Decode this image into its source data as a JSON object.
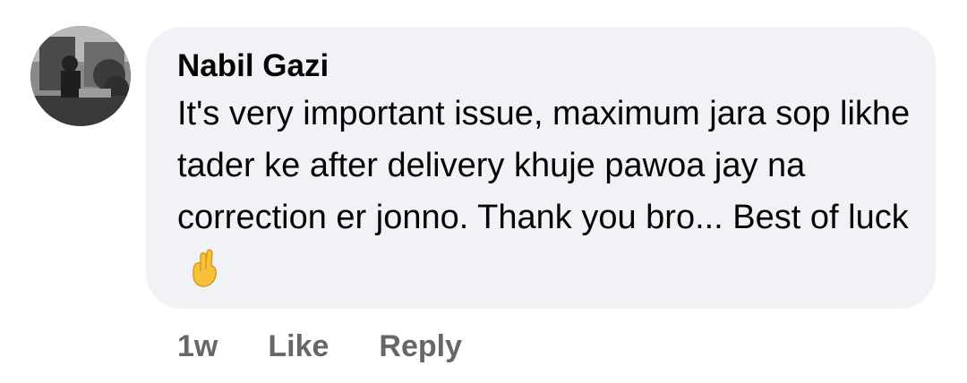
{
  "comment": {
    "author": "Nabil Gazi",
    "text": "It's very important issue, maximum jara sop likhe tader ke after delivery khuje pawoa jay na correction er jonno. Thank you bro... Best of luck",
    "emoji": "crossed-fingers-icon",
    "timestamp": "1w",
    "like_label": "Like",
    "reply_label": "Reply"
  },
  "colors": {
    "bubble_bg": "#f0f2f5",
    "text": "#050505",
    "meta": "#65676b",
    "emoji": "#f7c23a"
  }
}
